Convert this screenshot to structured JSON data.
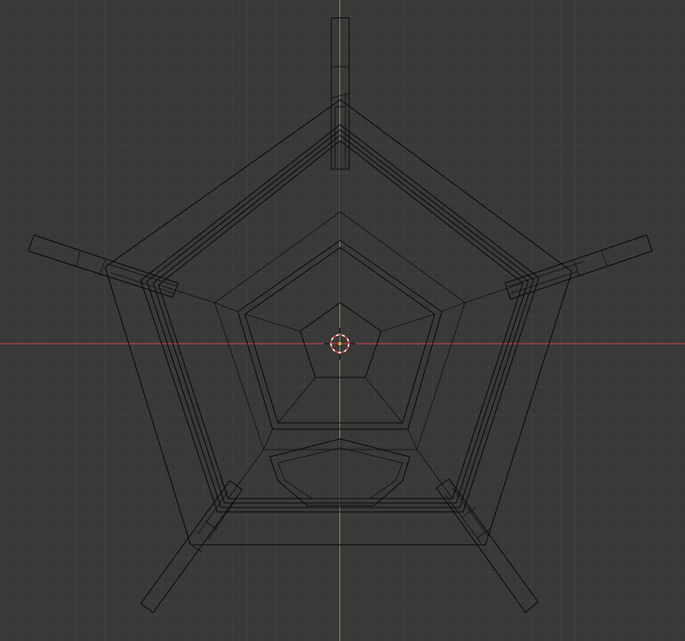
{
  "viewport": {
    "background_color": "#393939",
    "grid_minor_color": "#434343",
    "grid_major_color": "#4a4a4a",
    "x_axis_color": "#c8454f",
    "y_axis_color": "#6c9a2a",
    "wireframe_color": "#0a0a0a",
    "origin_marker_color": "#e39a2c",
    "cursor_ring_colors": [
      "#e03c3c",
      "#ffffff"
    ]
  },
  "icons": {
    "cursor": "3d-cursor-icon",
    "origin": "object-origin-icon"
  }
}
